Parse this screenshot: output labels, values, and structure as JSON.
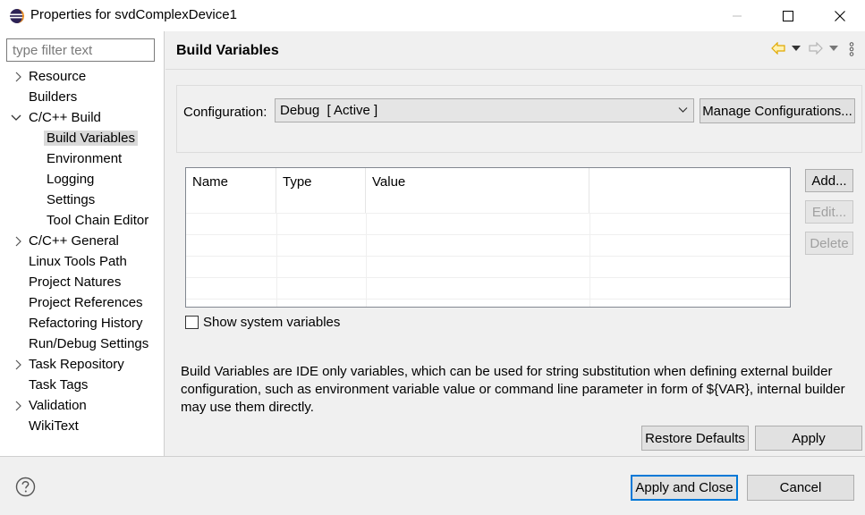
{
  "window": {
    "title": "Properties for svdComplexDevice1",
    "minimize_icon": "minimize-icon",
    "maximize_icon": "maximize-icon",
    "close_icon": "close-icon"
  },
  "sidebar": {
    "filter_placeholder": "type filter text",
    "items": [
      {
        "label": "Resource",
        "expander": "collapsed"
      },
      {
        "label": "Builders",
        "expander": "none"
      },
      {
        "label": "C/C++ Build",
        "expander": "expanded"
      },
      {
        "label": "Build Variables",
        "expander": "none",
        "selected": true
      },
      {
        "label": "Environment",
        "expander": "none"
      },
      {
        "label": "Logging",
        "expander": "none"
      },
      {
        "label": "Settings",
        "expander": "none"
      },
      {
        "label": "Tool Chain Editor",
        "expander": "none"
      },
      {
        "label": "C/C++ General",
        "expander": "collapsed"
      },
      {
        "label": "Linux Tools Path",
        "expander": "none"
      },
      {
        "label": "Project Natures",
        "expander": "none"
      },
      {
        "label": "Project References",
        "expander": "none"
      },
      {
        "label": "Refactoring History",
        "expander": "none"
      },
      {
        "label": "Run/Debug Settings",
        "expander": "none"
      },
      {
        "label": "Task Repository",
        "expander": "collapsed"
      },
      {
        "label": "Task Tags",
        "expander": "none"
      },
      {
        "label": "Validation",
        "expander": "collapsed"
      },
      {
        "label": "WikiText",
        "expander": "none"
      }
    ]
  },
  "page": {
    "title": "Build Variables",
    "configuration_label": "Configuration:",
    "configuration_value": "Debug  [ Active ]",
    "manage_button": "Manage Configurations...",
    "table": {
      "columns": [
        "Name",
        "Type",
        "Value",
        ""
      ],
      "rows": []
    },
    "add_button": "Add...",
    "edit_button": "Edit...",
    "delete_button": "Delete",
    "show_system_label": "Show system variables",
    "show_system_checked": false,
    "description": "Build Variables are IDE only variables, which can be used for string substitution when defining external builder configuration, such as environment variable value or command line parameter in form of ${VAR}, internal builder may use them directly.",
    "restore_button": "Restore Defaults",
    "apply_button": "Apply"
  },
  "footer": {
    "apply_close_button": "Apply and Close",
    "cancel_button": "Cancel"
  },
  "colors": {
    "accent": "#0078d7",
    "back_arrow": "#e0a800"
  }
}
